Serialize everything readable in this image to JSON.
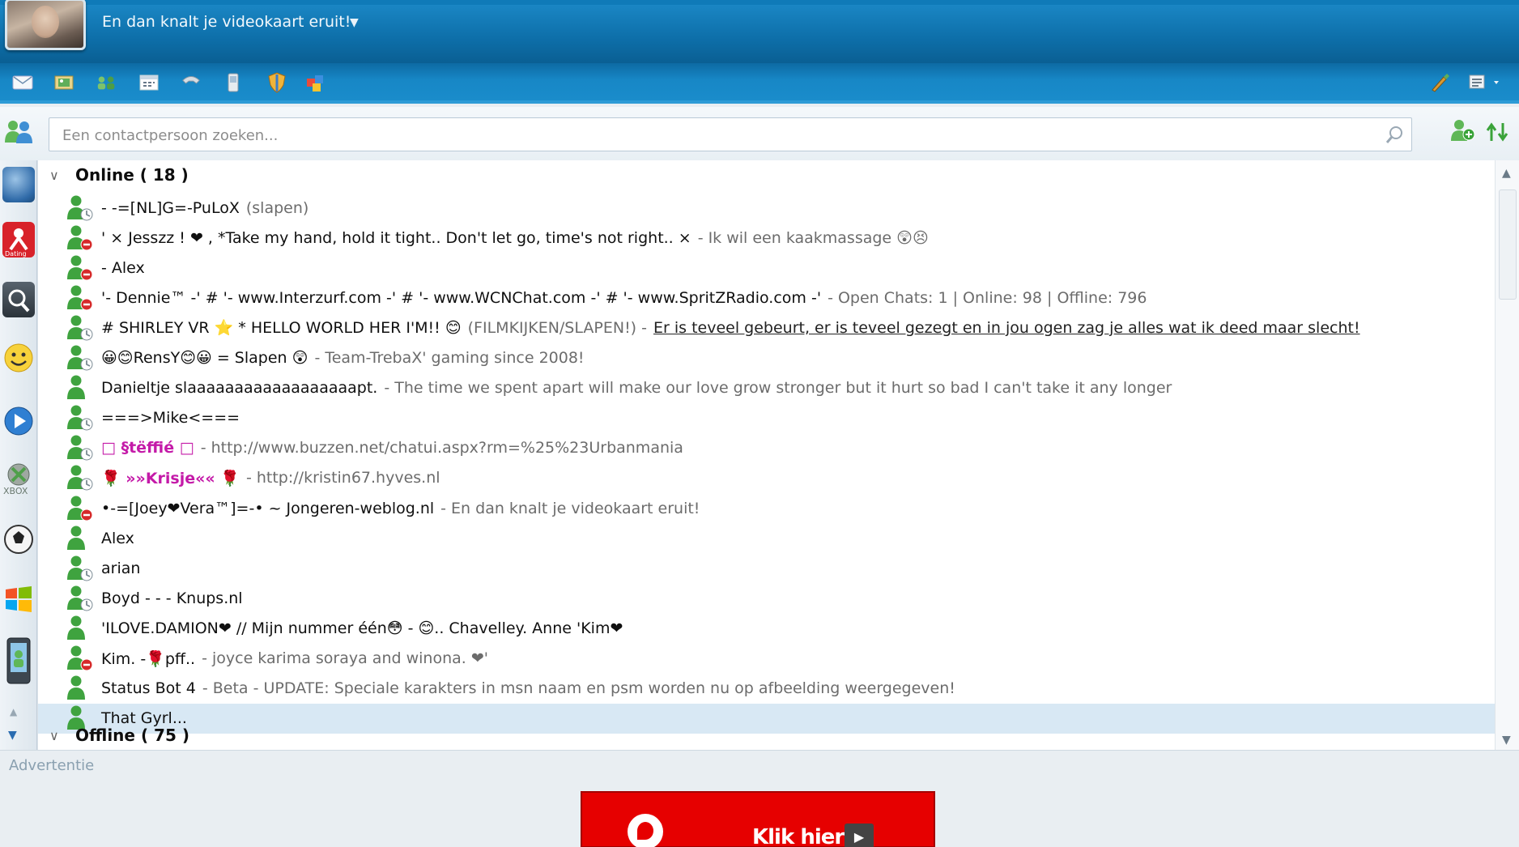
{
  "header": {
    "personal_message": "En dan knalt je videokaart eruit!",
    "dropdown_icon": "chevron-down-icon"
  },
  "toolbar": {
    "icons": [
      "mail-icon",
      "photos-icon",
      "contacts-icon",
      "calendar-icon",
      "phone-icon",
      "mobile-icon",
      "shield-icon",
      "games-icon",
      "paint-icon",
      "menu-icon"
    ]
  },
  "search": {
    "placeholder": "Een contactpersoon zoeken..."
  },
  "groups": {
    "online": {
      "label": "Online ( 18 )"
    },
    "offline": {
      "label": "Offline ( 75 )"
    }
  },
  "contacts": [
    {
      "name": "-                -=[NL]G=-PuLoX",
      "psm": "(slapen)",
      "status": "away"
    },
    {
      "name": "'        ×  Jesszz  !  ❤   ,                    *Take my hand, hold it tight.. Don't let go, time's not right..  ×",
      "psm": "- Ik wil een kaakmassage 😲😣",
      "status": "busy"
    },
    {
      "name": "-   Alex",
      "psm": "",
      "status": "busy"
    },
    {
      "name": "'- Dennie™ -' # '- www.Interzurf.com -' # '- www.WCNChat.com -' # '- www.SpritZRadio.com -'",
      "psm": "- Open Chats: 1 | Online: 98 | Offline: 796",
      "status": "busy"
    },
    {
      "name": "#  SHIRLEY VR ⭐   *  HELLO WORLD HER I'M!! 😊",
      "psm": "(FILMKIJKEN/SLAPEN!) -",
      "link": "Er is teveel gebeurt, er is teveel gezegt en in jou ogen zag je alles wat ik deed maar slecht!",
      "status": "away"
    },
    {
      "name": "😀😊RensY😊😀 = Slapen 😲",
      "psm": "- Team-TrebaX' gaming since 2008!",
      "status": "away"
    },
    {
      "name": "Danieltje     slaaaaaaaaaaaaaaaaaapt.",
      "psm": "- The time we spent apart will make our love grow stronger but it hurt so bad I can't take it any longer",
      "status": "online"
    },
    {
      "name": "===>Mike<===",
      "psm": "",
      "status": "away"
    },
    {
      "name": "□ §tëffié □",
      "psm": "- http://www.buzzen.net/chatui.aspx?rm=%25%23Urbanmania",
      "status": "away"
    },
    {
      "name": "🌹 »»Krisje«« 🌹",
      "psm": "- http://kristin67.hyves.nl",
      "status": "away"
    },
    {
      "name": "•-=[Joey❤Vera™]=-• ~ Jongeren-weblog.nl",
      "psm": "- En dan knalt je videokaart eruit!",
      "status": "busy"
    },
    {
      "name": "Alex",
      "psm": "",
      "status": "online"
    },
    {
      "name": "arian",
      "psm": "",
      "status": "away"
    },
    {
      "name": "Boyd - - - Knups.nl",
      "psm": "",
      "status": "away"
    },
    {
      "name": "'ILOVE.DAMION❤ //        Mijn nummer één😳 - 😊..              Chavelley. Anne 'Kim❤",
      "psm": "",
      "status": "online"
    },
    {
      "name": "Kim.  -🌹pff..",
      "psm": "- joyce karima soraya and winona. ❤'",
      "status": "busy"
    },
    {
      "name": "Status Bot 4",
      "psm": "- Beta - UPDATE: Speciale karakters in msn naam en psm worden nu op afbeelding weergegeven!",
      "status": "online"
    },
    {
      "name": "That Gyrl...",
      "psm": "",
      "status": "online",
      "selected": true
    }
  ],
  "sidebar": {
    "icons": [
      "globe-icon",
      "dating-icon",
      "search-app-icon",
      "smiley-icon",
      "media-player-icon",
      "xbox-icon",
      "soccer-icon",
      "windows-icon",
      "mobile-app-icon"
    ]
  },
  "ad": {
    "label": "Advertentie",
    "banner_text": "Klik hier"
  },
  "colors": {
    "header_blue": "#0d6ea8",
    "status_online": "#3fa33f",
    "status_away": "#f1c232",
    "status_busy": "#d62a2a",
    "selection": "#d8e8f4",
    "ad_red": "#e60000"
  }
}
